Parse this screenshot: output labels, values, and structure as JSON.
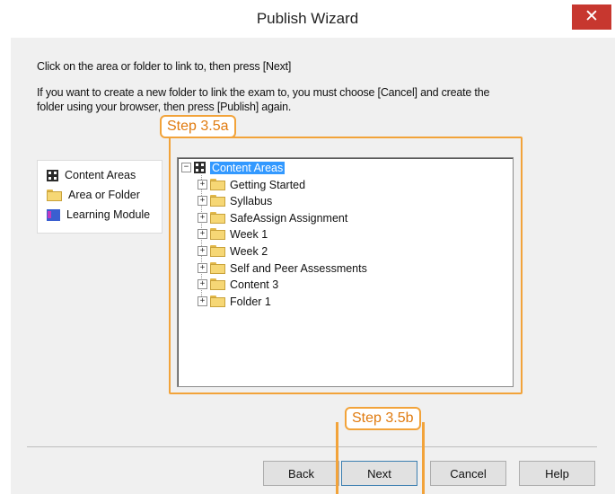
{
  "window": {
    "title": "Publish Wizard",
    "close_glyph": "✕"
  },
  "instructions": {
    "line1": "Click on the area or folder to link to, then press [Next]",
    "line2": "If you want to create a new folder to link the exam to, you must choose [Cancel] and create the",
    "line3": "folder using your browser, then press [Publish] again."
  },
  "legend": {
    "items": [
      {
        "label": "Content Areas",
        "icon": "content-areas-icon"
      },
      {
        "label": "Area or Folder",
        "icon": "folder-icon"
      },
      {
        "label": "Learning Module",
        "icon": "learning-module-icon"
      }
    ]
  },
  "annotations": {
    "step_a": "Step 3.5a",
    "step_b": "Step 3.5b",
    "color": "#f2a33a"
  },
  "tree": {
    "root": {
      "label": "Content Areas",
      "expander": "−",
      "selected": true
    },
    "children": [
      {
        "label": "Getting Started",
        "expander": "+"
      },
      {
        "label": "Syllabus",
        "expander": "+"
      },
      {
        "label": "SafeAssign Assignment",
        "expander": "+"
      },
      {
        "label": "Week 1",
        "expander": "+"
      },
      {
        "label": "Week 2",
        "expander": "+"
      },
      {
        "label": "Self and Peer Assessments",
        "expander": "+"
      },
      {
        "label": "Content 3",
        "expander": "+"
      },
      {
        "label": "Folder 1",
        "expander": "+"
      }
    ]
  },
  "buttons": {
    "back": "Back",
    "next": "Next",
    "cancel": "Cancel",
    "help": "Help"
  }
}
